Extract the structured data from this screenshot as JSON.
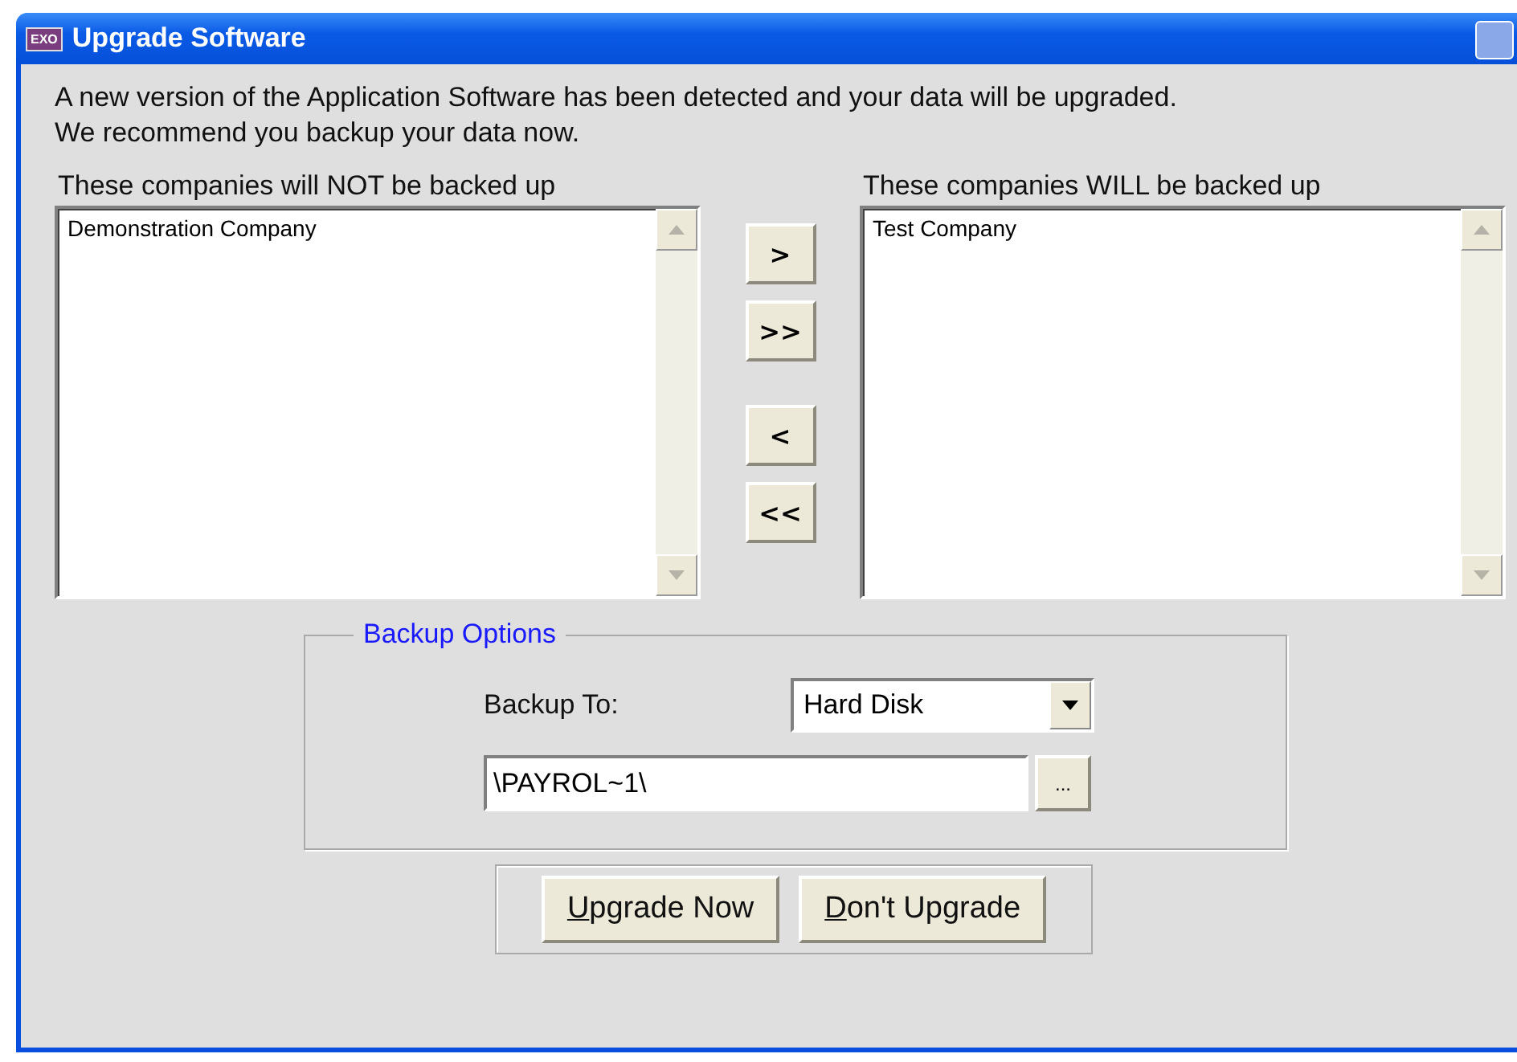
{
  "window": {
    "title": "Upgrade Software",
    "app_badge": "EXO"
  },
  "message": [
    "A new version of the Application Software has been detected and your data will be upgraded.",
    "We recommend you backup your data now."
  ],
  "lists": [
    {
      "heading": "These companies will NOT be backed up",
      "items": [
        "Demonstration Company"
      ]
    },
    {
      "heading": "These companies WILL be backed up",
      "items": [
        "Test Company"
      ]
    }
  ],
  "move_buttons": [
    ">",
    ">>",
    "<",
    "<<"
  ],
  "backup_options": {
    "title": "Backup Options",
    "backup_to_label": "Backup To:",
    "backup_to_value": "Hard Disk",
    "path_value": "\\PAYROL~1\\",
    "browse_button": "..."
  },
  "buttons": [
    {
      "access_key": "U",
      "label_rest": "pgrade Now"
    },
    {
      "access_key": "D",
      "label_rest": "on't Upgrade"
    }
  ]
}
